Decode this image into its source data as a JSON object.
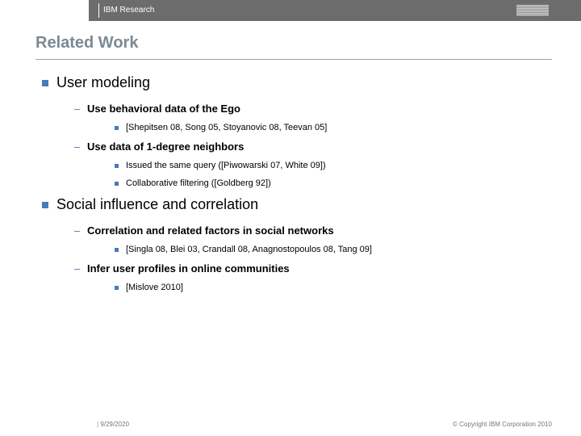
{
  "header": {
    "org": "IBM Research"
  },
  "title": "Related Work",
  "sections": [
    {
      "heading": "User modeling",
      "items": [
        {
          "label": "Use behavioral data of the Ego",
          "sub": [
            "[Shepitsen 08, Song 05, Stoyanovic 08, Teevan 05]"
          ]
        },
        {
          "label": "Use data of 1-degree neighbors",
          "sub": [
            "Issued the same query ([Piwowarski 07, White 09])",
            "Collaborative filtering ([Goldberg 92])"
          ]
        }
      ]
    },
    {
      "heading": "Social influence and correlation",
      "items": [
        {
          "label": "Correlation and related factors in social networks",
          "sub": [
            "[Singla 08, Blei 03, Crandall 08, Anagnostopoulos 08, Tang 09]"
          ]
        },
        {
          "label": "Infer user profiles in online communities",
          "sub": [
            "[Mislove 2010]"
          ]
        }
      ]
    }
  ],
  "footer": {
    "date": "9/29/2020",
    "copyright": "© Copyright IBM Corporation 2010"
  }
}
